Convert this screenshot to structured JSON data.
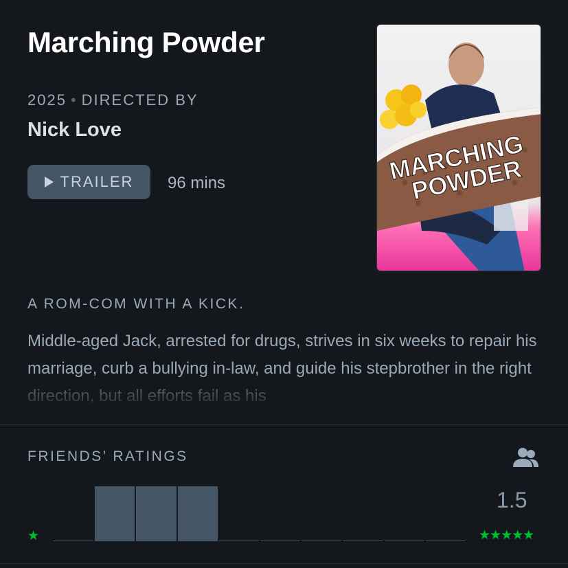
{
  "film": {
    "title": "Marching Powder",
    "year": "2025",
    "directed_by_label": "DIRECTED BY",
    "director": "Nick Love",
    "trailer_label": "TRAILER",
    "runtime": "96 mins",
    "poster_title_line1": "MARCHING",
    "poster_title_line2": "POWDER",
    "tagline": "A ROM-COM WITH A KICK.",
    "synopsis": "Middle-aged Jack, arrested for drugs, strives in six weeks to repair his marriage, curb a bullying in-law, and guide his stepbrother in the right direction, but all efforts fail as his"
  },
  "ratings": {
    "heading": "FRIENDS’ RATINGS",
    "average": "1.5",
    "min_star": "★",
    "max_stars": "★★★★★",
    "histogram_fractions": [
      0,
      1,
      1,
      1,
      0,
      0,
      0,
      0,
      0,
      0
    ],
    "bar_color": "#445566",
    "star_color": "#00c030"
  },
  "icons": {
    "play": "play-icon",
    "friends": "friends-icon"
  }
}
